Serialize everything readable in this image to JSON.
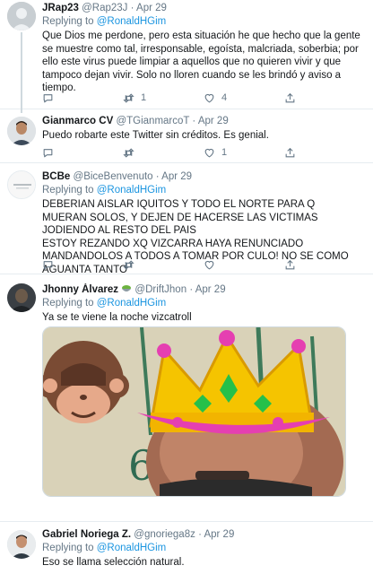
{
  "tweets": [
    {
      "name": "JRap23",
      "handle": "@Rap23J",
      "dot": "·",
      "time": "Apr 29",
      "reply_prefix": "Replying to",
      "reply_to": "@RonaldHGim",
      "text": "Que Dios me perdone, pero esta situación he que hecho que la gente se muestre como tal, irresponsable, egoísta, malcriada, soberbia; por ello este virus  puede limpiar a aquellos que no quieren vivir y que tampoco dejan vivir. Solo no lloren cuando se les brindó y aviso a tiempo.",
      "retweets": "1",
      "likes": "4"
    },
    {
      "name": "Gianmarco CV",
      "handle": "@TGianmarcoT",
      "dot": "·",
      "time": "Apr 29",
      "text": "Puedo robarte este Twitter sin créditos. Es genial.",
      "replies": "",
      "retweets": "",
      "likes": "1"
    },
    {
      "name": "BCBe",
      "handle": "@BiceBenvenuto",
      "dot": "·",
      "time": "Apr 29",
      "reply_prefix": "Replying to",
      "reply_to": "@RonaldHGim",
      "text": "DEBERIAN AISLAR IQUITOS Y TODO EL NORTE PARA Q MUERAN SOLOS, Y DEJEN DE HACERSE LAS VICTIMAS JODIENDO AL RESTO DEL PAIS\nESTOY REZANDO XQ VIZCARRA HAYA RENUNCIADO MANDANDOLOS A TODOS A TOMAR POR CULO! NO SE COMO AGUANTA TANTO"
    },
    {
      "name": "Jhonny Álvarez",
      "handle": "@DriftJhon",
      "dot": "·",
      "time": "Apr 29",
      "reply_prefix": "Replying to",
      "reply_to": "@RonaldHGim",
      "text": "Ya se te viene la noche vizcatroll"
    },
    {
      "name": "Gabriel Noriega Z.",
      "handle": "@gnoriega8z",
      "dot": "·",
      "time": "Apr 29",
      "reply_prefix": "Replying to",
      "reply_to": "@RonaldHGim",
      "text": "Eso se llama selección natural."
    }
  ],
  "icons": {
    "reply": "reply-icon",
    "retweet": "retweet-icon",
    "like": "heart-icon",
    "share": "share-icon",
    "emoji": "salad-bowl-emoji",
    "monkey": "see-no-evil-monkey-emoji",
    "crown": "crown-sticker"
  },
  "colors": {
    "link": "#1b95e0",
    "secondary": "#657786",
    "border": "#e6ecf0"
  }
}
